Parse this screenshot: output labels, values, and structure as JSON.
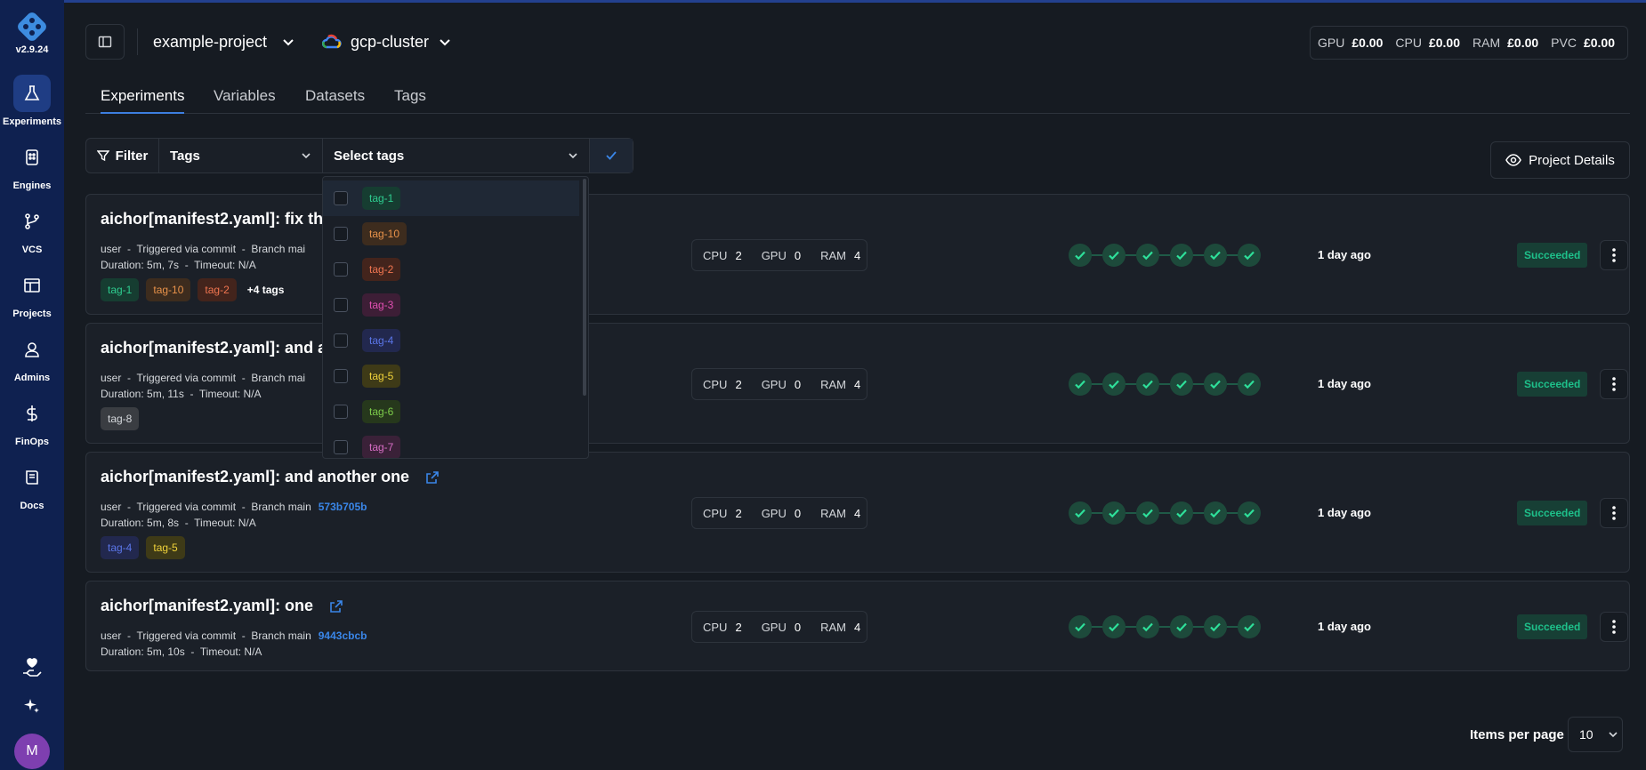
{
  "app": {
    "version": "v2.9.24"
  },
  "sidebar": {
    "items": [
      {
        "label": "Experiments",
        "icon": "flask-icon",
        "active": true
      },
      {
        "label": "Engines",
        "icon": "engine-icon",
        "active": false
      },
      {
        "label": "VCS",
        "icon": "git-branch-icon",
        "active": false
      },
      {
        "label": "Projects",
        "icon": "projects-icon",
        "active": false
      },
      {
        "label": "Admins",
        "icon": "admins-icon",
        "active": false
      },
      {
        "label": "FinOps",
        "icon": "dollar-icon",
        "active": false
      },
      {
        "label": "Docs",
        "icon": "book-icon",
        "active": false
      }
    ],
    "avatar_initial": "M"
  },
  "header": {
    "project": "example-project",
    "cluster": "gcp-cluster",
    "costs": [
      {
        "label": "GPU",
        "value": "£0.00"
      },
      {
        "label": "CPU",
        "value": "£0.00"
      },
      {
        "label": "RAM",
        "value": "£0.00"
      },
      {
        "label": "PVC",
        "value": "£0.00"
      }
    ]
  },
  "tabs": [
    {
      "label": "Experiments",
      "active": true
    },
    {
      "label": "Variables",
      "active": false
    },
    {
      "label": "Datasets",
      "active": false
    },
    {
      "label": "Tags",
      "active": false
    }
  ],
  "filter": {
    "filter_label": "Filter",
    "field_value": "Tags",
    "select_placeholder": "Select tags"
  },
  "project_details_label": "Project Details",
  "tag_colors": {
    "tag-1": {
      "bg": "#163d31",
      "fg": "#2ecc8f"
    },
    "tag-10": {
      "bg": "#3d2c1e",
      "fg": "#e8924a"
    },
    "tag-2": {
      "bg": "#43241c",
      "fg": "#f07550"
    },
    "tag-3": {
      "bg": "#3d1e36",
      "fg": "#e14fb2"
    },
    "tag-4": {
      "bg": "#22284e",
      "fg": "#5b76e8"
    },
    "tag-5": {
      "bg": "#3e3a17",
      "fg": "#f0d23a"
    },
    "tag-6": {
      "bg": "#26381c",
      "fg": "#7ccb4a"
    },
    "tag-7": {
      "bg": "#3a2138",
      "fg": "#d66dc4"
    },
    "tag-8": {
      "bg": "#3a3d42",
      "fg": "#d5d8dc"
    }
  },
  "dropdown": {
    "options": [
      "tag-1",
      "tag-10",
      "tag-2",
      "tag-3",
      "tag-4",
      "tag-5",
      "tag-6",
      "tag-7"
    ]
  },
  "experiments": [
    {
      "title": "aichor[manifest2.yaml]: fix th",
      "meta": "user  -  Triggered via commit  -  Branch mai",
      "hash": "",
      "duration": "Duration: 5m, 7s  -  Timeout: N/A",
      "tags": [
        "tag-1",
        "tag-10",
        "tag-2"
      ],
      "more_tags": "+4 tags",
      "cpu": "2",
      "gpu": "0",
      "ram": "4",
      "ago": "1 day ago",
      "status": "Succeeded",
      "show_link": false
    },
    {
      "title": "aichor[manifest2.yaml]: and a",
      "meta": "user  -  Triggered via commit  -  Branch mai",
      "hash": "",
      "duration": "Duration: 5m, 11s  -  Timeout: N/A",
      "tags": [
        "tag-8"
      ],
      "more_tags": "",
      "cpu": "2",
      "gpu": "0",
      "ram": "4",
      "ago": "1 day ago",
      "status": "Succeeded",
      "show_link": false
    },
    {
      "title": "aichor[manifest2.yaml]: and another one",
      "meta": "user  -  Triggered via commit  -  Branch main",
      "hash": "573b705b",
      "duration": "Duration: 5m, 8s  -  Timeout: N/A",
      "tags": [
        "tag-4",
        "tag-5"
      ],
      "more_tags": "",
      "cpu": "2",
      "gpu": "0",
      "ram": "4",
      "ago": "1 day ago",
      "status": "Succeeded",
      "show_link": true
    },
    {
      "title": "aichor[manifest2.yaml]: one",
      "meta": "user  -  Triggered via commit  -  Branch main",
      "hash": "9443cbcb",
      "duration": "Duration: 5m, 10s  -  Timeout: N/A",
      "tags": [],
      "more_tags": "",
      "cpu": "2",
      "gpu": "0",
      "ram": "4",
      "ago": "1 day ago",
      "status": "Succeeded",
      "show_link": true
    }
  ],
  "resource_labels": {
    "cpu": "CPU",
    "gpu": "GPU",
    "ram": "RAM"
  },
  "pagination": {
    "label": "Items per page",
    "value": "10"
  }
}
